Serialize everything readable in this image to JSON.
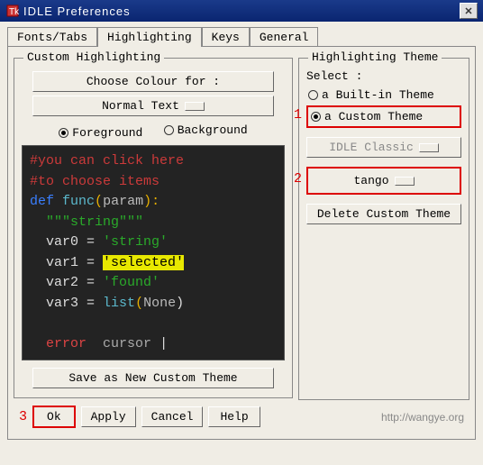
{
  "window": {
    "title": "IDLE Preferences"
  },
  "tabs": [
    "Fonts/Tabs",
    "Highlighting",
    "Keys",
    "General"
  ],
  "active_tab": 1,
  "custom_highlighting": {
    "title": "Custom Highlighting",
    "choose_colour_label": "Choose Colour for :",
    "normal_text_label": "Normal Text",
    "fg_label": "Foreground",
    "bg_label": "Background",
    "fg_bg_selected": "Foreground",
    "code": {
      "line1": "#you can click here",
      "line2": "#to choose items",
      "kw_def": "def",
      "func": "func",
      "lparen": "(",
      "param": "param",
      "rparen_colon": "):",
      "triple": "\"\"\"string\"\"\"",
      "var0": "var0",
      "var1": "var1",
      "var2": "var2",
      "var3": "var3",
      "eq": " = ",
      "s1": "'string'",
      "s2": "'selected'",
      "s3": "'found'",
      "list": "list",
      "none": "None",
      "error": "error",
      "cursor": "cursor",
      "pipe": "|"
    },
    "save_btn": "Save as New Custom Theme"
  },
  "highlighting_theme": {
    "title": "Highlighting Theme",
    "select_label": "Select :",
    "builtin_label": "a Built-in Theme",
    "custom_label": "a Custom Theme",
    "selected": "custom",
    "builtin_dropdown": "IDLE Classic",
    "custom_dropdown": "tango",
    "delete_btn": "Delete Custom Theme"
  },
  "annotations": {
    "one": "1",
    "two": "2",
    "three": "3"
  },
  "buttons": {
    "ok": "Ok",
    "apply": "Apply",
    "cancel": "Cancel",
    "help": "Help"
  },
  "footer_url": "http://wangye.org"
}
